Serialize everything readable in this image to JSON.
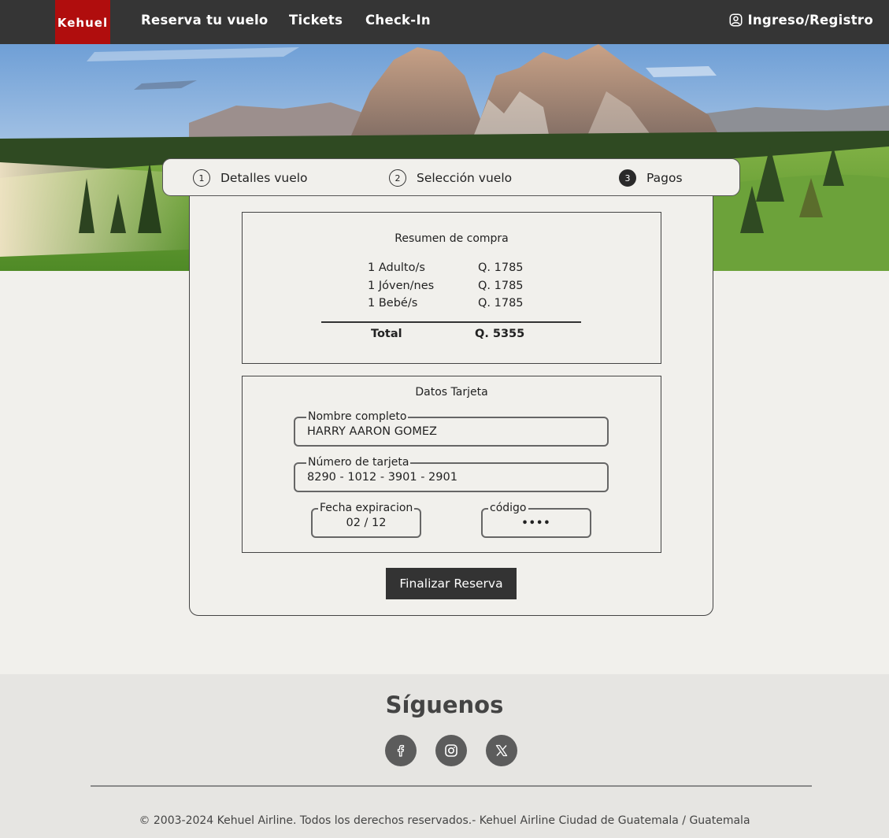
{
  "brand": {
    "logo_text": "Kehuel",
    "logo_color": "#b00d0d"
  },
  "nav": {
    "links": [
      "Reserva tu vuelo",
      "Tickets",
      "Check-In"
    ],
    "login_label": "Ingreso/Registro"
  },
  "stepper": {
    "steps": [
      {
        "number": "1",
        "label": "Detalles vuelo",
        "active": false
      },
      {
        "number": "2",
        "label": "Selección vuelo",
        "active": false
      },
      {
        "number": "3",
        "label": "Pagos",
        "active": true
      }
    ]
  },
  "summary": {
    "title": "Resumen de compra",
    "rows": [
      {
        "label": "1 Adulto/s",
        "value": "Q. 1785"
      },
      {
        "label": "1 Jóven/nes",
        "value": "Q. 1785"
      },
      {
        "label": "1 Bebé/s",
        "value": "Q. 1785"
      }
    ],
    "total_label": "Total",
    "total_value": "Q. 5355"
  },
  "card": {
    "title": "Datos Tarjeta",
    "name_label": "Nombre completo",
    "name_value": "HARRY AARON GOMEZ",
    "number_label": "Número de tarjeta",
    "number_value": "8290 - 1012 - 3901 - 2901",
    "expiry_label": "Fecha expiracion",
    "expiry_value": "02 / 12",
    "cvv_label": "código",
    "cvv_value": "••••"
  },
  "submit_label": "Finalizar Reserva",
  "footer": {
    "follow_title": "Síguenos",
    "social_icons": [
      "facebook-icon",
      "instagram-icon",
      "x-icon"
    ],
    "copyright": "© 2003-2024 Kehuel Airline. Todos los derechos reservados.- Kehuel Airline Ciudad de Guatemala / Guatemala"
  }
}
